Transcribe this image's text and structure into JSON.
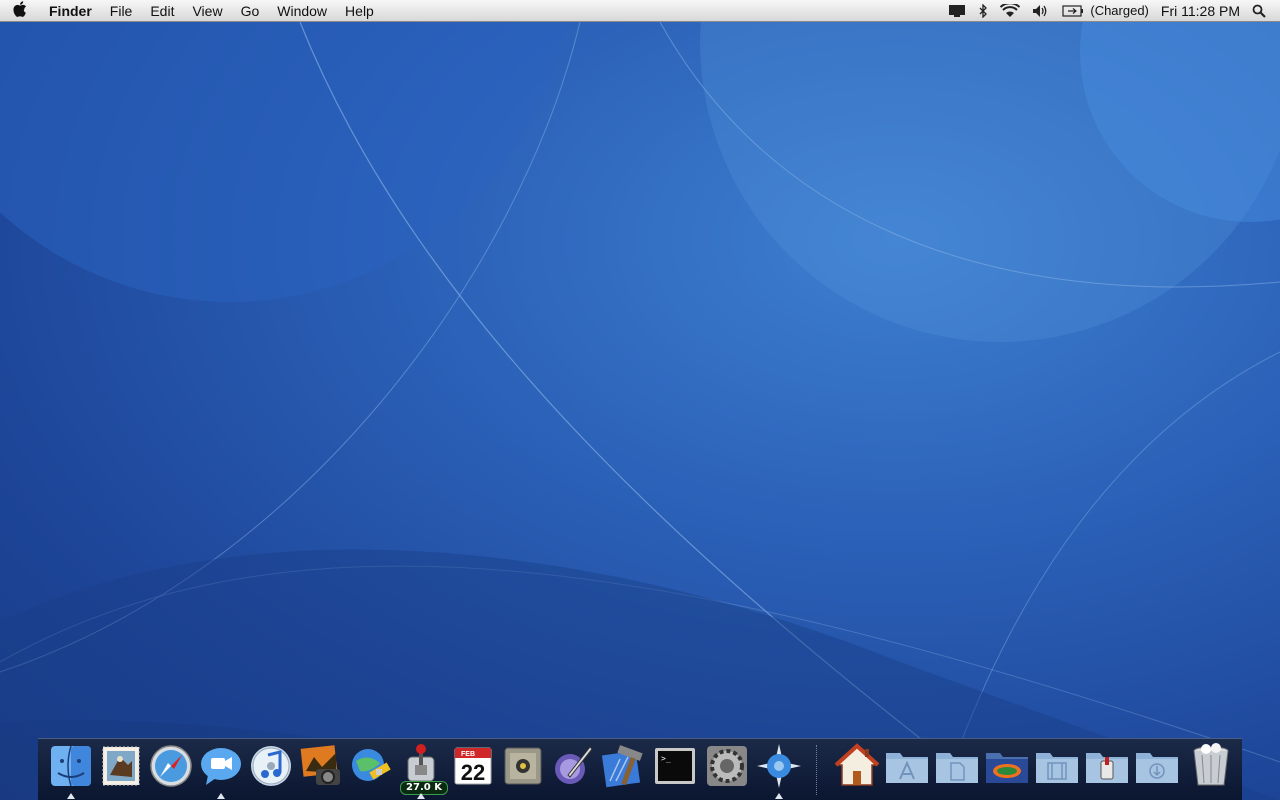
{
  "menubar": {
    "apple_icon": "apple-logo-icon",
    "app_name": "Finder",
    "menus": [
      "File",
      "Edit",
      "View",
      "Go",
      "Window",
      "Help"
    ],
    "status": {
      "battery_text": "(Charged)",
      "clock": "Fri 11:28 PM"
    },
    "status_icons": [
      "display-icon",
      "bluetooth-icon",
      "wifi-icon",
      "volume-icon",
      "battery-icon",
      "spotlight-icon"
    ]
  },
  "dock": {
    "apps": [
      {
        "name": "Finder",
        "icon": "finder-icon",
        "running": true
      },
      {
        "name": "Mail",
        "icon": "mail-stamp-icon",
        "running": false
      },
      {
        "name": "Safari",
        "icon": "safari-compass-icon",
        "running": false
      },
      {
        "name": "iChat",
        "icon": "ichat-icon",
        "running": true
      },
      {
        "name": "iTunes",
        "icon": "itunes-icon",
        "running": false
      },
      {
        "name": "iPhoto",
        "icon": "iphoto-icon",
        "running": false
      },
      {
        "name": "Network Utility",
        "icon": "globe-satellite-icon",
        "running": false
      },
      {
        "name": "Transmission",
        "icon": "transmission-icon",
        "running": true,
        "badge": "27.0 K"
      },
      {
        "name": "iCal",
        "icon": "calendar-icon",
        "running": false,
        "month": "FEB",
        "day": "22"
      },
      {
        "name": "Time Machine Vault",
        "icon": "vault-icon",
        "running": false
      },
      {
        "name": "Quill",
        "icon": "quill-pen-icon",
        "running": false
      },
      {
        "name": "Xcode",
        "icon": "xcode-hammer-icon",
        "running": false
      },
      {
        "name": "Terminal",
        "icon": "terminal-icon",
        "running": false,
        "prompt": ">_"
      },
      {
        "name": "System Preferences",
        "icon": "system-preferences-gear-icon",
        "running": false
      },
      {
        "name": "Camino",
        "icon": "camino-compass-icon",
        "running": true
      }
    ],
    "stacks": [
      {
        "name": "Home",
        "icon": "home-icon"
      },
      {
        "name": "Applications",
        "icon": "applications-folder-icon"
      },
      {
        "name": "Documents",
        "icon": "documents-folder-icon"
      },
      {
        "name": "Gators",
        "icon": "gator-folder-icon"
      },
      {
        "name": "Movies",
        "icon": "movies-folder-icon"
      },
      {
        "name": "Utilities",
        "icon": "utilities-folder-icon"
      },
      {
        "name": "Downloads",
        "icon": "downloads-folder-icon"
      },
      {
        "name": "Trash",
        "icon": "trash-icon"
      }
    ]
  },
  "colors": {
    "wallpaper_light": "#3d7fd0",
    "wallpaper_dark": "#183a85",
    "dock_bg": "#0b1630",
    "folder_blue": "#8fb3d8"
  }
}
